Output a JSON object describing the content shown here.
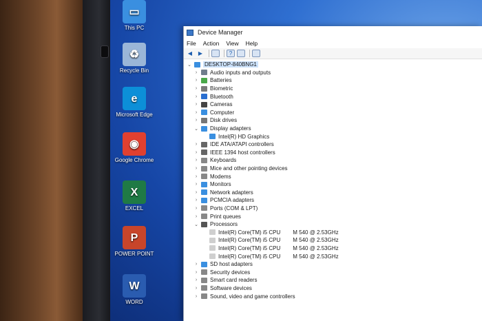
{
  "desktop": {
    "icons": [
      {
        "name": "This PC",
        "color": "#3a8fe0",
        "glyph": "▭"
      },
      {
        "name": "Recycle Bin",
        "color": "#9ab6d8",
        "glyph": "♻"
      },
      {
        "name": "Microsoft Edge",
        "color": "#0c8fd8",
        "glyph": "e"
      },
      {
        "name": "Google Chrome",
        "color": "#e04030",
        "glyph": "◉"
      },
      {
        "name": "EXCEL",
        "color": "#1f7a45",
        "glyph": "X"
      },
      {
        "name": "POWER POINT",
        "color": "#c8452a",
        "glyph": "P"
      },
      {
        "name": "WORD",
        "color": "#2a5cb0",
        "glyph": "W"
      }
    ]
  },
  "window": {
    "title": "Device Manager",
    "menu": [
      "File",
      "Action",
      "View",
      "Help"
    ],
    "toolbar": [
      "back-arrow-icon",
      "forward-arrow-icon",
      "properties-icon",
      "help-icon",
      "update-icon",
      "monitor-icon"
    ]
  },
  "tree": {
    "root": "DESKTOP-840BNG1",
    "items": [
      {
        "label": "Audio inputs and outputs",
        "expanded": false,
        "color": "#6f7d8c"
      },
      {
        "label": "Batteries",
        "expanded": false,
        "color": "#4aa84a"
      },
      {
        "label": "Biometric",
        "expanded": false,
        "color": "#7a7a7a"
      },
      {
        "label": "Bluetooth",
        "expanded": false,
        "color": "#2a6fd0"
      },
      {
        "label": "Cameras",
        "expanded": false,
        "color": "#444444"
      },
      {
        "label": "Computer",
        "expanded": false,
        "color": "#3a8fe0"
      },
      {
        "label": "Disk drives",
        "expanded": false,
        "color": "#777777"
      },
      {
        "label": "Display adapters",
        "expanded": true,
        "color": "#3a8fe0",
        "children": [
          {
            "label": "Intel(R) HD Graphics"
          }
        ]
      },
      {
        "label": "IDE ATA/ATAPI controllers",
        "expanded": false,
        "color": "#666666"
      },
      {
        "label": "IEEE 1394 host controllers",
        "expanded": false,
        "color": "#666666"
      },
      {
        "label": "Keyboards",
        "expanded": false,
        "color": "#888888"
      },
      {
        "label": "Mice and other pointing devices",
        "expanded": false,
        "color": "#888888"
      },
      {
        "label": "Modems",
        "expanded": false,
        "color": "#888888"
      },
      {
        "label": "Monitors",
        "expanded": false,
        "color": "#3a8fe0"
      },
      {
        "label": "Network adapters",
        "expanded": false,
        "color": "#3a8fe0"
      },
      {
        "label": "PCMCIA adapters",
        "expanded": false,
        "color": "#3a8fe0"
      },
      {
        "label": "Ports (COM & LPT)",
        "expanded": false,
        "color": "#888888"
      },
      {
        "label": "Print queues",
        "expanded": false,
        "color": "#888888"
      },
      {
        "label": "Processors",
        "expanded": true,
        "color": "#555555",
        "children": [
          {
            "label": "Intel(R) Core(TM) i5 CPU",
            "freq": "M 540  @ 2.53GHz"
          },
          {
            "label": "Intel(R) Core(TM) i5 CPU",
            "freq": "M 540  @ 2.53GHz"
          },
          {
            "label": "Intel(R) Core(TM) i5 CPU",
            "freq": "M 540  @ 2.53GHz"
          },
          {
            "label": "Intel(R) Core(TM) i5 CPU",
            "freq": "M 540  @ 2.53GHz"
          }
        ]
      },
      {
        "label": "SD host adapters",
        "expanded": false,
        "color": "#3a8fe0"
      },
      {
        "label": "Security devices",
        "expanded": false,
        "color": "#888888"
      },
      {
        "label": "Smart card readers",
        "expanded": false,
        "color": "#888888"
      },
      {
        "label": "Software devices",
        "expanded": false,
        "color": "#888888"
      },
      {
        "label": "Sound, video and game controllers",
        "expanded": false,
        "color": "#888888"
      }
    ]
  }
}
